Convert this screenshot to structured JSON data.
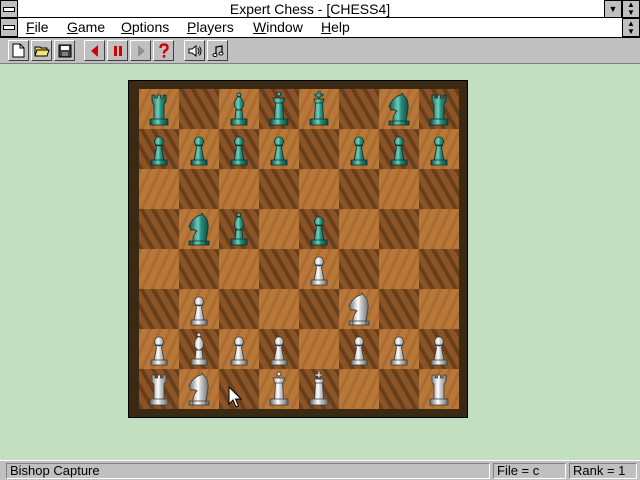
{
  "window": {
    "title": "Expert Chess - [CHESS4]"
  },
  "menu": [
    {
      "pre": "",
      "ul": "F",
      "post": "ile"
    },
    {
      "pre": "",
      "ul": "G",
      "post": "ame"
    },
    {
      "pre": "",
      "ul": "O",
      "post": "ptions"
    },
    {
      "pre": "",
      "ul": "P",
      "post": "layers"
    },
    {
      "pre": "",
      "ul": "W",
      "post": "indow"
    },
    {
      "pre": "",
      "ul": "H",
      "post": "elp"
    }
  ],
  "toolbar": [
    {
      "icon": "new-document-icon"
    },
    {
      "icon": "open-folder-icon"
    },
    {
      "icon": "save-disk-icon"
    },
    {
      "icon": "rewind-icon"
    },
    {
      "icon": "pause-icon"
    },
    {
      "icon": "play-forward-icon"
    },
    {
      "icon": "hint-question-icon"
    },
    {
      "icon": "sound-icon"
    },
    {
      "icon": "music-icon"
    }
  ],
  "colors": {
    "background": "#c2dfc2",
    "teal_piece": "#2a8c7c",
    "silver_piece": "#c8c8c8",
    "light_square": "#b9783a",
    "dark_square": "#8a5427"
  },
  "board": {
    "rows": [
      [
        "tR",
        "",
        "tB",
        "tQ",
        "tK",
        "",
        "tN",
        "tR"
      ],
      [
        "tP",
        "tP",
        "tP",
        "tP",
        "",
        "tP",
        "tP",
        "tP"
      ],
      [
        "",
        "",
        "",
        "",
        "",
        "",
        "",
        ""
      ],
      [
        "",
        "tN",
        "tB",
        "",
        "tP",
        "",
        "",
        ""
      ],
      [
        "",
        "",
        "",
        "",
        "sP",
        "",
        "",
        ""
      ],
      [
        "",
        "sP",
        "",
        "",
        "",
        "sN",
        "",
        ""
      ],
      [
        "sP",
        "sB",
        "sP",
        "sP",
        "",
        "sP",
        "sP",
        "sP"
      ],
      [
        "sR",
        "sN",
        "",
        "sQ",
        "sK",
        "",
        "",
        "sR"
      ]
    ]
  },
  "status": {
    "message": "Bishop Capture",
    "file": "File = c",
    "rank": "Rank = 1"
  }
}
